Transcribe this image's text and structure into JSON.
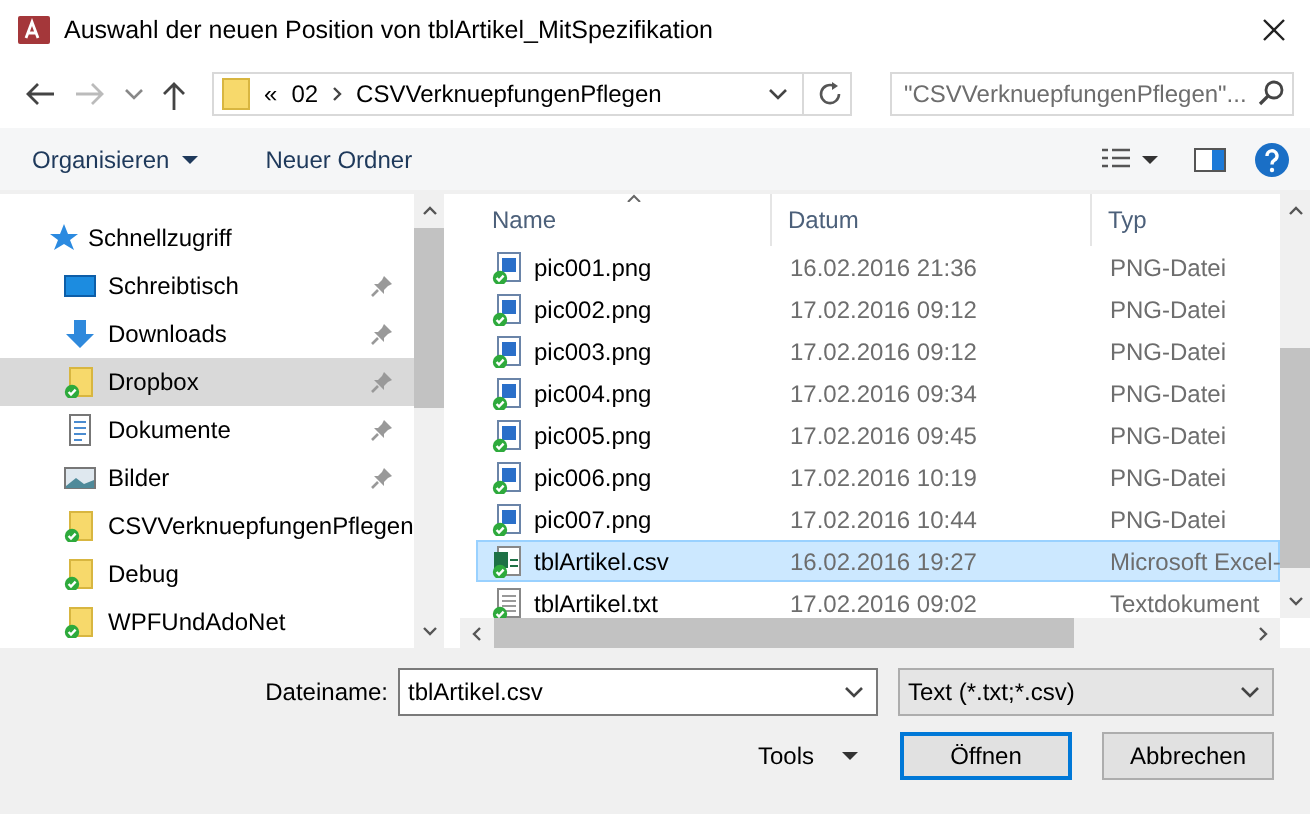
{
  "window": {
    "title": "Auswahl der neuen Position von tblArtikel_MitSpezifikation"
  },
  "address": {
    "prefix": "«",
    "segments": [
      "02",
      "CSVVerknuepfungenPflegen"
    ]
  },
  "search": {
    "placeholder": "\"CSVVerknuepfungenPflegen\"..."
  },
  "toolbar": [
    {
      "label": "Organisieren",
      "dropdown": true
    },
    {
      "label": "Neuer Ordner",
      "dropdown": false
    }
  ],
  "sidebar": {
    "items": [
      {
        "label": "Schnellzugriff",
        "kind": "quick",
        "pinned": false,
        "selected": false,
        "children": [
          {
            "label": "Schreibtisch",
            "kind": "desktop",
            "pinned": true,
            "selected": false
          },
          {
            "label": "Downloads",
            "kind": "downloads",
            "pinned": true,
            "selected": false
          },
          {
            "label": "Dropbox",
            "kind": "synced-folder",
            "pinned": true,
            "selected": true
          },
          {
            "label": "Dokumente",
            "kind": "documents",
            "pinned": true,
            "selected": false
          },
          {
            "label": "Bilder",
            "kind": "pictures",
            "pinned": true,
            "selected": false
          },
          {
            "label": "CSVVerknuepfungenPflegen",
            "kind": "synced-folder",
            "pinned": false,
            "selected": false
          },
          {
            "label": "Debug",
            "kind": "synced-folder",
            "pinned": false,
            "selected": false
          },
          {
            "label": "WPFUndAdoNet",
            "kind": "synced-folder",
            "pinned": false,
            "selected": false
          }
        ]
      }
    ]
  },
  "table": {
    "columns": [
      "Name",
      "Datum",
      "Typ"
    ],
    "rows": [
      {
        "name": "pic001.png",
        "date": "16.02.2016 21:36",
        "type": "PNG-Datei",
        "kind": "image",
        "selected": false
      },
      {
        "name": "pic002.png",
        "date": "17.02.2016 09:12",
        "type": "PNG-Datei",
        "kind": "image",
        "selected": false
      },
      {
        "name": "pic003.png",
        "date": "17.02.2016 09:12",
        "type": "PNG-Datei",
        "kind": "image",
        "selected": false
      },
      {
        "name": "pic004.png",
        "date": "17.02.2016 09:34",
        "type": "PNG-Datei",
        "kind": "image",
        "selected": false
      },
      {
        "name": "pic005.png",
        "date": "17.02.2016 09:45",
        "type": "PNG-Datei",
        "kind": "image",
        "selected": false
      },
      {
        "name": "pic006.png",
        "date": "17.02.2016 10:19",
        "type": "PNG-Datei",
        "kind": "image",
        "selected": false
      },
      {
        "name": "pic007.png",
        "date": "17.02.2016 10:44",
        "type": "PNG-Datei",
        "kind": "image",
        "selected": false
      },
      {
        "name": "tblArtikel.csv",
        "date": "16.02.2016 19:27",
        "type": "Microsoft Excel-",
        "kind": "spreadsheet",
        "selected": true
      },
      {
        "name": "tblArtikel.txt",
        "date": "17.02.2016 09:02",
        "type": "Textdokument",
        "kind": "text",
        "selected": false
      }
    ]
  },
  "footer": {
    "filename_label": "Dateiname:",
    "filename": "tblArtikel.csv",
    "filter": "Text (*.txt;*.csv)",
    "tools": "Tools",
    "buttons": [
      {
        "label": "Öffnen",
        "default": true
      },
      {
        "label": "Abbrechen",
        "default": false
      }
    ]
  }
}
